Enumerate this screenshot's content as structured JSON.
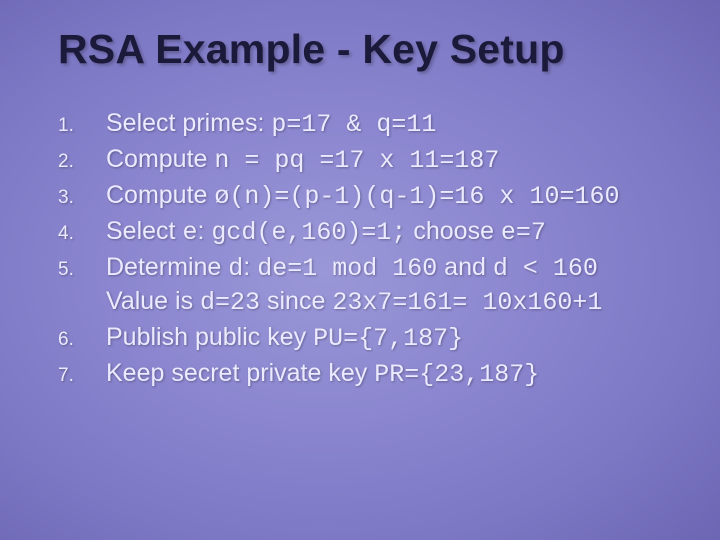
{
  "title": "RSA Example - Key Setup",
  "steps": [
    {
      "pre": "Select primes: ",
      "mono": "p=17 & q=11",
      "post": ""
    },
    {
      "pre": "Compute ",
      "mono": "n = pq =17 x 11=187",
      "post": ""
    },
    {
      "pre": "Compute ",
      "mono": "ø(n)=(p-1)(q-1)=16 x 10=160",
      "post": ""
    },
    {
      "pre": "Select ",
      "mono": "e",
      "post": ": ",
      "mono2": "gcd(e,160)=1;",
      "post2": " choose ",
      "mono3": "e=7"
    },
    {
      "pre": "Determine ",
      "mono": "d",
      "post": ": ",
      "mono2": "de=1 mod 160",
      "post2": " and ",
      "mono3": "d < 160",
      "cont_pre": "Value is ",
      "cont_mono": "d=23",
      "cont_mid": " since ",
      "cont_mono2": "23x7=161= 10x160+1"
    },
    {
      "pre": "Publish public key ",
      "mono": "PU={7,187}",
      "post": ""
    },
    {
      "pre": "Keep secret private key ",
      "mono": "PR={23,187}",
      "post": ""
    }
  ]
}
